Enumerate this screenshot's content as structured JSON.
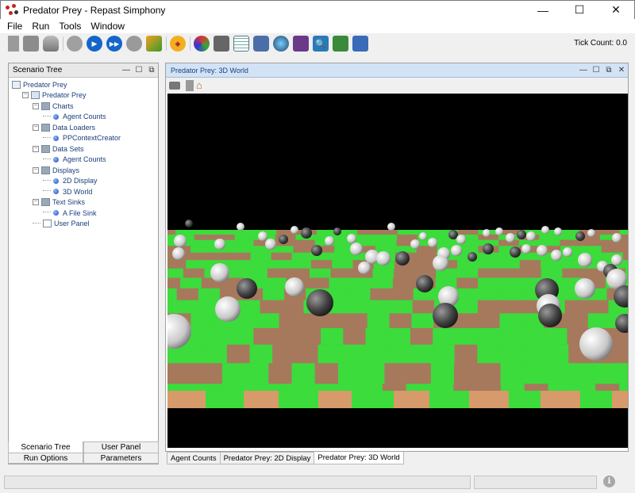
{
  "window": {
    "title": "Predator Prey - Repast Simphony",
    "minimize": "—",
    "maximize": "☐",
    "close": "✕"
  },
  "menu": [
    "File",
    "Run",
    "Tools",
    "Window"
  ],
  "toolbar": {
    "icons": [
      "save-model-icon",
      "save-icon",
      "database-icon",
      "initialize-icon",
      "start-run-icon",
      "step-run-icon",
      "stop-run-icon",
      "reset-icon",
      "pause-icon",
      "palette-icon",
      "disk-icon",
      "table-icon",
      "server-icon",
      "globe-icon",
      "network-icon",
      "search-icon",
      "batch-icon",
      "grid-icon"
    ],
    "tick_count_label": "Tick Count: 0.0"
  },
  "scenario_tree": {
    "title": "Scenario Tree",
    "items": [
      {
        "label": "Predator Prey",
        "depth": 0,
        "kind": "root"
      },
      {
        "label": "Predator Prey",
        "depth": 1,
        "kind": "model"
      },
      {
        "label": "Charts",
        "depth": 2,
        "kind": "folder"
      },
      {
        "label": "Agent Counts",
        "depth": 3,
        "kind": "leaf"
      },
      {
        "label": "Data Loaders",
        "depth": 2,
        "kind": "folder"
      },
      {
        "label": "PPContextCreator",
        "depth": 3,
        "kind": "leaf"
      },
      {
        "label": "Data Sets",
        "depth": 2,
        "kind": "folder"
      },
      {
        "label": "Agent Counts",
        "depth": 3,
        "kind": "leaf"
      },
      {
        "label": "Displays",
        "depth": 2,
        "kind": "folder"
      },
      {
        "label": "2D Display",
        "depth": 3,
        "kind": "leaf"
      },
      {
        "label": "3D World",
        "depth": 3,
        "kind": "leaf"
      },
      {
        "label": "Text Sinks",
        "depth": 2,
        "kind": "folder"
      },
      {
        "label": "A File Sink",
        "depth": 3,
        "kind": "leaf"
      },
      {
        "label": "User Panel",
        "depth": 2,
        "kind": "panel"
      }
    ]
  },
  "left_tabs": {
    "top": [
      "Scenario Tree",
      "User Panel"
    ],
    "bottom": [
      "Run Options",
      "Parameters"
    ],
    "active": "Scenario Tree"
  },
  "display_panel": {
    "title": "Predator Prey: 3D World",
    "tabs": [
      "Agent Counts",
      "Predator Prey: 2D Display",
      "Predator Prey: 3D World"
    ],
    "active_tab": "Predator Prey: 3D World"
  },
  "colors": {
    "grass": "#3bdc3b",
    "dirt": "#a6795c",
    "sheep": "#e8e8e8",
    "wolf": "#555555",
    "sky": "#000000"
  }
}
